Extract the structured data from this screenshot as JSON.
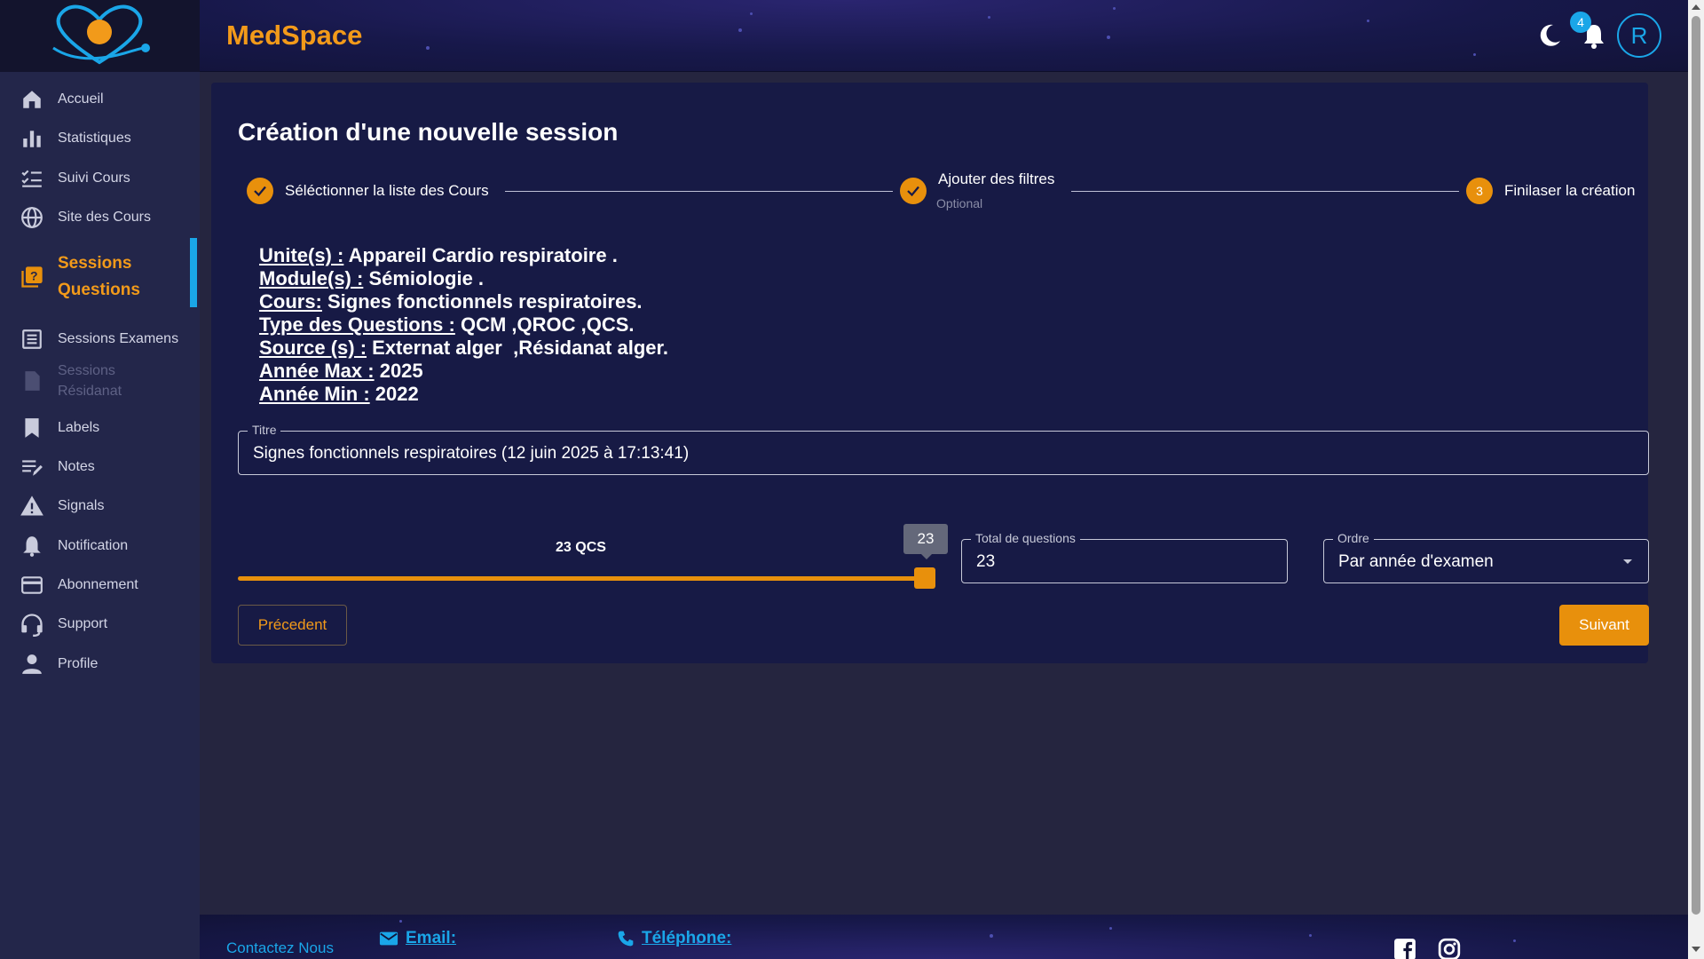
{
  "app": {
    "title": "MedSpace"
  },
  "topbar": {
    "notification_count": "4",
    "avatar_letter": "R"
  },
  "sidebar": {
    "items": [
      {
        "label": "Accueil",
        "icon": "home-icon"
      },
      {
        "label": "Statistiques",
        "icon": "bar-chart-icon"
      },
      {
        "label": "Suivi Cours",
        "icon": "checklist-icon"
      },
      {
        "label": "Site des Cours",
        "icon": "globe-icon"
      },
      {
        "label": "Sessions Questions",
        "icon": "question-box-icon",
        "active": true
      },
      {
        "label": "Sessions Examens",
        "icon": "list-box-icon"
      },
      {
        "label": "Sessions Résidanat",
        "icon": "document-icon",
        "disabled": true
      },
      {
        "label": "Labels",
        "icon": "bookmark-icon"
      },
      {
        "label": "Notes",
        "icon": "notes-icon"
      },
      {
        "label": "Signals",
        "icon": "warning-icon"
      },
      {
        "label": "Notification",
        "icon": "bell-icon"
      },
      {
        "label": "Abonnement",
        "icon": "credit-card-icon"
      },
      {
        "label": "Support",
        "icon": "headset-icon"
      },
      {
        "label": "Profile",
        "icon": "person-icon"
      }
    ]
  },
  "main": {
    "title": "Création d'une nouvelle session",
    "steps": [
      {
        "label": "Séléctionner la liste des Cours",
        "state": "done"
      },
      {
        "label": "Ajouter des filtres",
        "sublabel": "Optional",
        "state": "done"
      },
      {
        "label": "Finilaser la création",
        "number": "3",
        "state": "active"
      }
    ],
    "summary": [
      {
        "key": "Unite(s) :",
        "value": " Appareil Cardio respiratoire ."
      },
      {
        "key": "Module(s) :",
        "value": " Sémiologie ."
      },
      {
        "key": "Cours:",
        "value": " Signes fonctionnels respiratoires."
      },
      {
        "key": "Type des Questions :",
        "value": " QCM ,QROC ,QCS."
      },
      {
        "key": "Source (s) :",
        "value": " Externat alger  ,Résidanat alger."
      },
      {
        "key": "Année Max :",
        "value": " 2025"
      },
      {
        "key": "Année Min :",
        "value": " 2022"
      }
    ],
    "title_field": {
      "label": "Titre",
      "value": "Signes fonctionnels respiratoires (12 juin 2025 à 17:13:41)"
    },
    "slider": {
      "label": "23 QCS",
      "value": "23",
      "fraction": 1.0
    },
    "total_field": {
      "label": "Total de questions",
      "value": "23"
    },
    "order_field": {
      "label": "Ordre",
      "value": "Par année d'examen"
    },
    "prev_button": "Précedent",
    "next_button": "Suivant"
  },
  "footer": {
    "contact": "Contactez Nous",
    "email_label": "Email:",
    "phone_label": "Téléphone:"
  },
  "colors": {
    "accent": "#e8900c",
    "brand_title": "#f29a1a",
    "link": "#1aa6e8",
    "card_bg": "#171a45",
    "sidebar_bg": "#23264a"
  }
}
